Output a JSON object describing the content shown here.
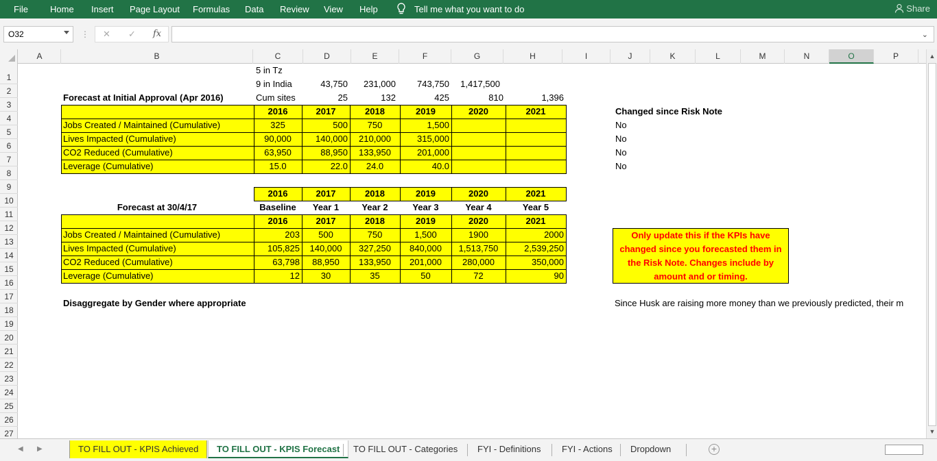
{
  "ribbon": {
    "tabs": [
      "File",
      "Home",
      "Insert",
      "Page Layout",
      "Formulas",
      "Data",
      "Review",
      "View",
      "Help"
    ],
    "tell_me": "Tell me what you want to do",
    "share": "Share"
  },
  "formula_bar": {
    "name_box": "O32",
    "cancel": "✕",
    "enter": "✓",
    "fx": "fx",
    "formula": ""
  },
  "columns": [
    "A",
    "B",
    "C",
    "D",
    "E",
    "F",
    "G",
    "H",
    "I",
    "J",
    "K",
    "L",
    "M",
    "N",
    "O",
    "P"
  ],
  "selected_column": "O",
  "rows": [
    "1",
    "2",
    "3",
    "4",
    "5",
    "6",
    "7",
    "8",
    "9",
    "10",
    "11",
    "12",
    "13",
    "14",
    "15",
    "16",
    "17",
    "18",
    "19",
    "20",
    "21",
    "22",
    "23",
    "24",
    "25",
    "26",
    "27"
  ],
  "cells": {
    "c0": "5 in Tz",
    "c1": "9 in India",
    "d1": "43,750",
    "e1": "231,000",
    "f1": "743,750",
    "g1": "1,417,500",
    "b2": "Forecast at Initial Approval (Apr 2016)",
    "c2": "Cum sites",
    "d2": "25",
    "e2": "132",
    "f2": "425",
    "g2": "810",
    "h2": "1,396",
    "t1_years": [
      "2016",
      "2017",
      "2018",
      "2019",
      "2020",
      "2021"
    ],
    "t1_rows": [
      {
        "label": "Jobs Created / Maintained (Cumulative)",
        "values": [
          "325",
          "500",
          "750",
          "1,500",
          "",
          ""
        ]
      },
      {
        "label": "Lives Impacted (Cumulative)",
        "values": [
          "90,000",
          "140,000",
          "210,000",
          "315,000",
          "",
          ""
        ]
      },
      {
        "label": "CO2 Reduced (Cumulative)",
        "values": [
          "63,950",
          "88,950",
          "133,950",
          "201,000",
          "",
          ""
        ]
      },
      {
        "label": "Leverage (Cumulative)",
        "values": [
          "15.0",
          "22.0",
          "24.0",
          "40.0",
          "",
          ""
        ]
      }
    ],
    "j3": "Changed since Risk Note",
    "changed": [
      "No",
      "No",
      "No",
      "No"
    ],
    "t2_years_top": [
      "2016",
      "2017",
      "2018",
      "2019",
      "2020",
      "2021"
    ],
    "b10": "Forecast at 30/4/17",
    "t2_periods": [
      "Baseline",
      "Year 1",
      "Year 2",
      "Year 3",
      "Year 4",
      "Year 5"
    ],
    "t2_years": [
      "2016",
      "2017",
      "2018",
      "2019",
      "2020",
      "2021"
    ],
    "t2_rows": [
      {
        "label": "Jobs Created / Maintained (Cumulative)",
        "values": [
          "203",
          "500",
          "750",
          "1,500",
          "1900",
          "2000"
        ]
      },
      {
        "label": "Lives Impacted (Cumulative)",
        "values": [
          "105,825",
          "140,000",
          "327,250",
          "840,000",
          "1,513,750",
          "2,539,250"
        ]
      },
      {
        "label": "CO2 Reduced (Cumulative)",
        "values": [
          "63,798",
          "88,950",
          "133,950",
          "201,000",
          "280,000",
          "350,000"
        ]
      },
      {
        "label": "Leverage (Cumulative)",
        "values": [
          "12",
          "30",
          "35",
          "50",
          "72",
          "90"
        ]
      }
    ],
    "note": [
      "Only update this if the KPIs have",
      "changed since you forecasted them in",
      "the Risk Note. Changes include by",
      "amount and or timing."
    ],
    "b17": "Disaggregate by Gender where appropriate",
    "j17": "Since Husk are raising more money than we previously predicted, their m"
  },
  "sheet_tabs": [
    {
      "label": "TO FILL OUT - KPIS Achieved",
      "style": "yellow"
    },
    {
      "label": "TO FILL OUT - KPIS Forecast",
      "style": "active"
    },
    {
      "label": "TO FILL OUT - Categories",
      "style": "normal"
    },
    {
      "label": "FYI - Definitions",
      "style": "normal"
    },
    {
      "label": "FYI - Actions",
      "style": "normal"
    },
    {
      "label": "Dropdown",
      "style": "normal"
    }
  ],
  "colors": {
    "excel_green": "#217346",
    "highlight": "#ffff00",
    "note_text": "#ff0000"
  },
  "icons": [
    "lightbulb-icon",
    "user-icon",
    "chevron-down-icon",
    "cancel-icon",
    "enter-icon",
    "fx-icon",
    "add-sheet-icon",
    "scroll-left-icon",
    "scroll-right-icon"
  ]
}
